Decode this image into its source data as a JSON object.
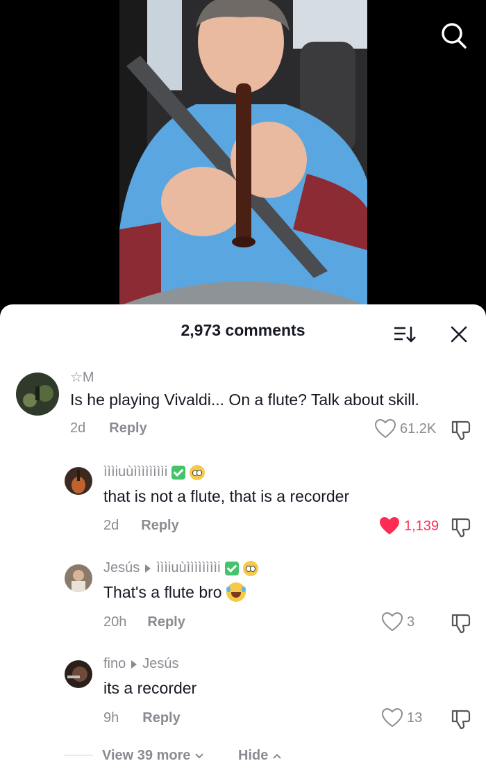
{
  "sheet": {
    "title": "2,973 comments"
  },
  "comments": [
    {
      "author": "☆M",
      "text": "Is he playing Vivaldi... On a flute? Talk about skill.",
      "age": "2d",
      "reply_label": "Reply",
      "likes": "61.2K",
      "liked": false
    },
    {
      "author": "ìììiuùììììììììi",
      "text": "that is not a flute, that is a recorder",
      "age": "2d",
      "reply_label": "Reply",
      "likes": "1,139",
      "liked": true
    },
    {
      "author": "Jesús",
      "reply_to": "ìììiuùììììììììi",
      "text": "That's a flute bro",
      "age": "20h",
      "reply_label": "Reply",
      "likes": "3",
      "liked": false
    },
    {
      "author": "fino",
      "reply_to": "Jesús",
      "text": "its a recorder",
      "age": "9h",
      "reply_label": "Reply",
      "likes": "13",
      "liked": false
    }
  ],
  "thread": {
    "view_more_label": "View 39 more",
    "hide_label": "Hide"
  },
  "colors": {
    "liked_heart": "#fe2c55",
    "secondary_text": "#8a8b91",
    "primary_text": "#161823"
  },
  "icons": [
    "search-icon",
    "sort-icon",
    "close-icon",
    "heart-icon",
    "dislike-icon",
    "chevron-down-icon",
    "chevron-up-icon"
  ]
}
